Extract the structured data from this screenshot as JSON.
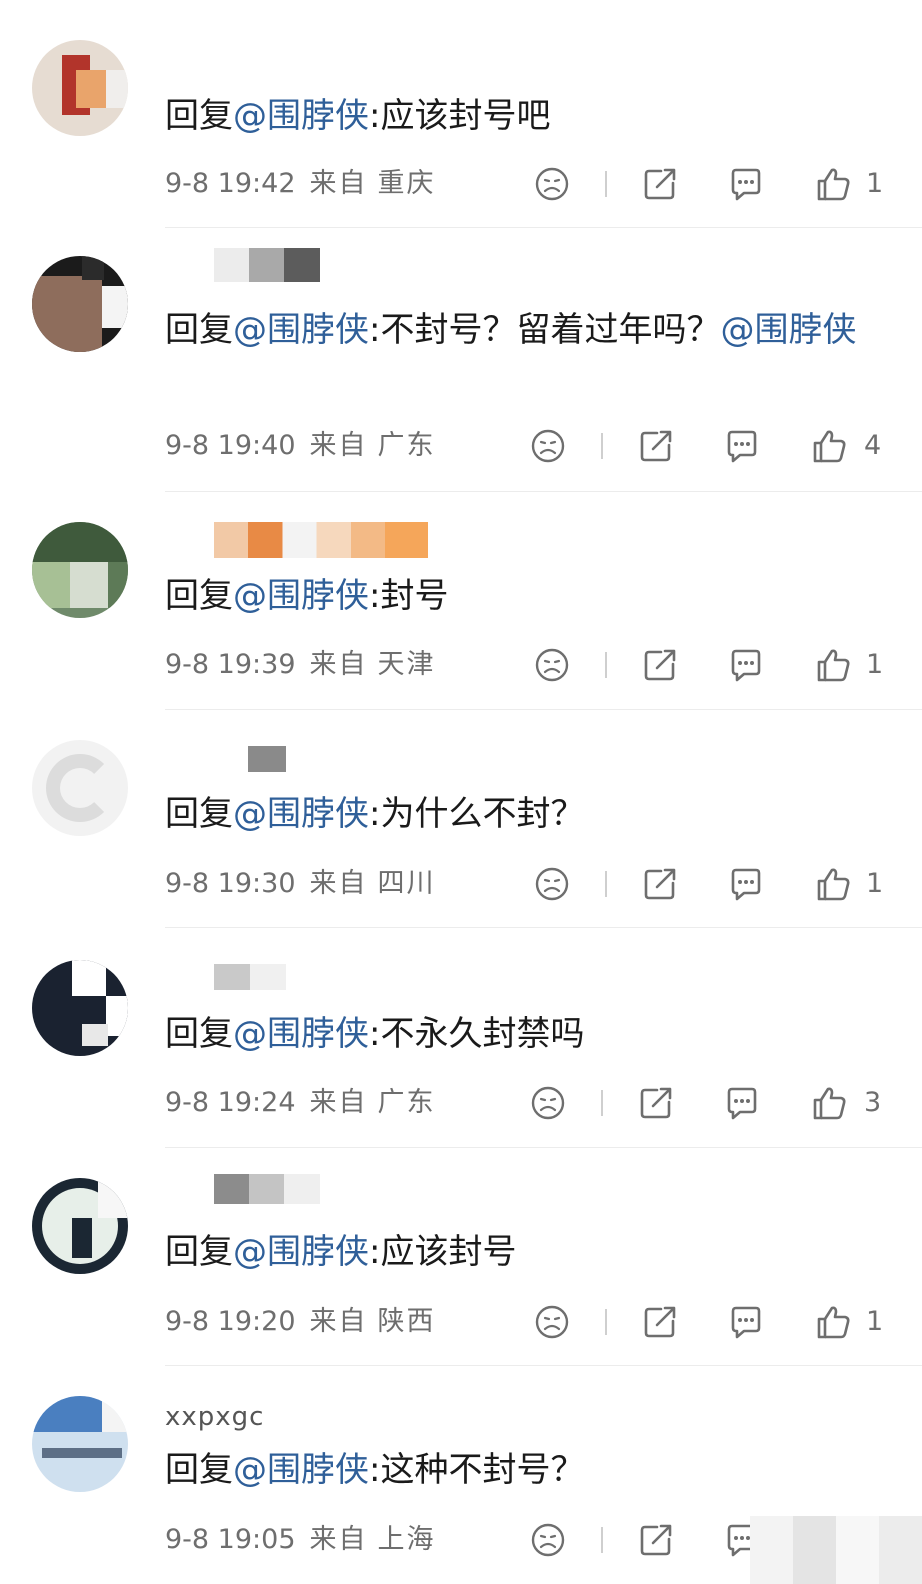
{
  "comments": [
    {
      "name": "",
      "reply": "回复",
      "mention": "@围脖侠",
      "rest": ":应该封号吧",
      "time": "9-8 19:42",
      "from": "来自",
      "location": "重庆",
      "likes": "1"
    },
    {
      "name": "",
      "reply": "回复",
      "mention": "@围脖侠",
      "rest": ":不封号？留着过年吗？",
      "mention2": "@围脖侠",
      "time": "9-8 19:40",
      "from": "来自",
      "location": "广东",
      "likes": "4"
    },
    {
      "name": "",
      "reply": "回复",
      "mention": "@围脖侠",
      "rest": ":封号",
      "time": "9-8 19:39",
      "from": "来自",
      "location": "天津",
      "likes": "1"
    },
    {
      "name": "",
      "reply": "回复",
      "mention": "@围脖侠",
      "rest": ":为什么不封？",
      "time": "9-8 19:30",
      "from": "来自",
      "location": "四川",
      "likes": "1"
    },
    {
      "name": "",
      "reply": "回复",
      "mention": "@围脖侠",
      "rest": ":不永久封禁吗",
      "time": "9-8 19:24",
      "from": "来自",
      "location": "广东",
      "likes": "3"
    },
    {
      "name": "",
      "reply": "回复",
      "mention": "@围脖侠",
      "rest": ":应该封号",
      "time": "9-8 19:20",
      "from": "来自",
      "location": "陕西",
      "likes": "1"
    },
    {
      "name": "xxpxgc",
      "reply": "回复",
      "mention": "@围脖侠",
      "rest": ":这种不封号？",
      "time": "9-8 19:05",
      "from": "来自",
      "location": "上海",
      "likes": ""
    }
  ],
  "icons": {
    "dislike": "frown-icon",
    "share": "share-icon",
    "comment": "comment-icon",
    "like": "thumbs-up-icon"
  },
  "colors": {
    "mention": "#2f5f99",
    "meta": "#6e6e6e"
  }
}
